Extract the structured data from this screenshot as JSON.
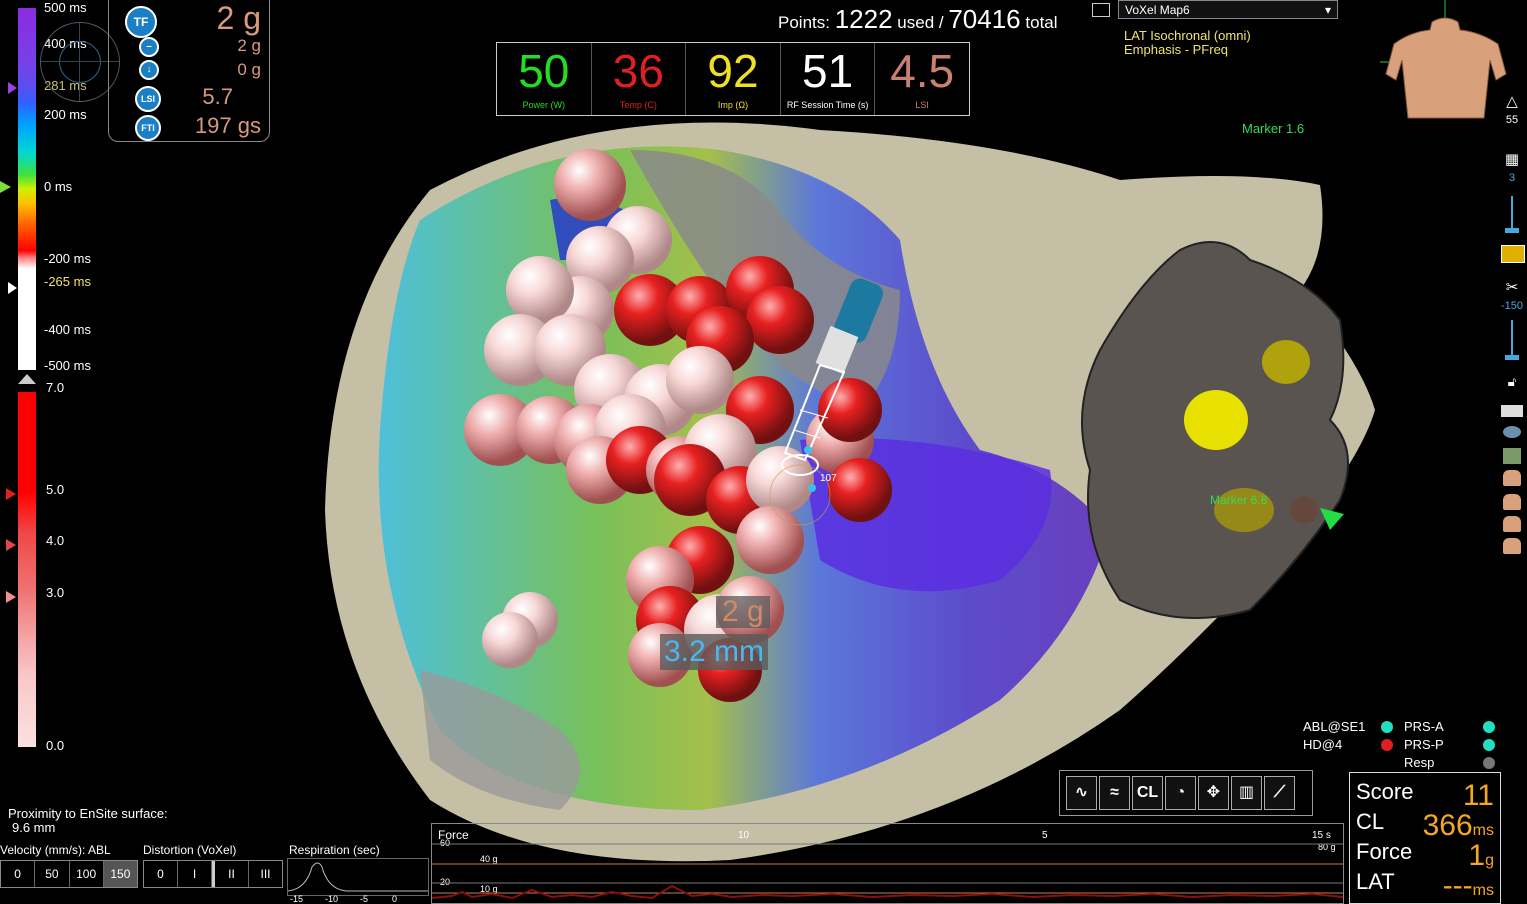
{
  "colors": {
    "lat_accent": "#8a2be2",
    "rf_power": "#22dd22",
    "rf_temp": "#e02020",
    "rf_imp": "#f0e020",
    "rf_session": "#ffffff",
    "rf_lsi": "#c88070",
    "score_orange": "#f5a623",
    "tf_text": "#d79a7e",
    "marker_green": "#33dd55"
  },
  "lat_scale": {
    "ticks": [
      "500 ms",
      "400 ms",
      "281 ms",
      "200 ms",
      "0 ms",
      "-200 ms",
      "-265 ms",
      "-400 ms",
      "-500 ms"
    ]
  },
  "force_scale": {
    "ticks": [
      "7.0",
      "5.0",
      "4.0",
      "3.0",
      "0.0"
    ]
  },
  "tf_panel": {
    "tf_icon": "TF",
    "tf_value": "2 g",
    "row2_value": "2 g",
    "row3_value": "0 g",
    "lsi_icon": "LSI",
    "lsi_value": "5.7",
    "fti_icon": "FTI",
    "fti_value": "197 gs"
  },
  "points": {
    "prefix": "Points:",
    "used": "1222",
    "used_label": "used /",
    "total": "70416",
    "total_label": "total"
  },
  "rf": [
    {
      "value": "50",
      "label": "Power (W)"
    },
    {
      "value": "36",
      "label": "Temp (C)"
    },
    {
      "value": "92",
      "label": "Imp (Ω)"
    },
    {
      "value": "51",
      "label": "RF Session Time (s)"
    },
    {
      "value": "4.5",
      "label": "LSI"
    }
  ],
  "map": {
    "selected": "VoXel Map6",
    "line1": "LAT Isochronal (omni)",
    "line2": "Emphasis - PFreq"
  },
  "markers": {
    "m1": "Marker 1.6",
    "m2": "Marker 6.8"
  },
  "overlay": {
    "force": "2 g",
    "distance": "3.2 mm",
    "catheter_label": "107"
  },
  "right_toolbar": {
    "v1": "55",
    "v2": "3",
    "v3": "-150"
  },
  "legend": {
    "abl": "ABL@SE1",
    "hd": "HD@4",
    "prs_a": "PRS-A",
    "prs_p": "PRS-P",
    "resp": "Resp"
  },
  "tools": {
    "cl": "CL"
  },
  "score": {
    "score_label": "Score",
    "score": "11",
    "cl_label": "CL",
    "cl": "366",
    "cl_unit": "ms",
    "force_label": "Force",
    "force": "1",
    "force_unit": "g",
    "lat_label": "LAT",
    "lat": "---",
    "lat_unit": "ms"
  },
  "proximity": {
    "label": "Proximity to EnSite surface:",
    "value": "9.6 mm"
  },
  "velocity": {
    "label": "Velocity (mm/s): ABL",
    "opts": [
      "0",
      "50",
      "100",
      "150"
    ]
  },
  "distortion": {
    "label": "Distortion (VoXel)",
    "opts": [
      "0",
      "I",
      "II",
      "III"
    ]
  },
  "respiration": {
    "label": "Respiration (sec)",
    "ticks": [
      "-15",
      "-10",
      "-5",
      "0"
    ]
  },
  "force_strip": {
    "label": "Force",
    "t1": "10",
    "t2": "5",
    "t3": "15 s",
    "y1": "60",
    "y2": "20",
    "g1": "40 g",
    "g2": "10 g",
    "gmax": "80 g"
  }
}
